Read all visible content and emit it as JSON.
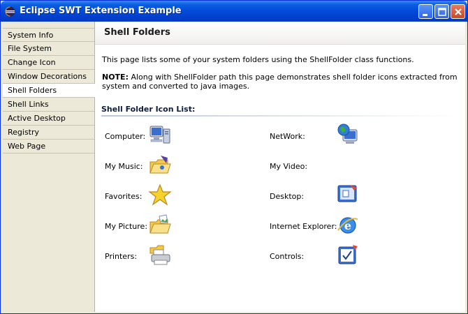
{
  "window": {
    "title": "Eclipse SWT Extension Example"
  },
  "sidebar": {
    "items": [
      {
        "label": "System Info"
      },
      {
        "label": "File System"
      },
      {
        "label": "Change Icon"
      },
      {
        "label": "Window Decorations"
      },
      {
        "label": "Shell Folders",
        "selected": true
      },
      {
        "label": "Shell Links"
      },
      {
        "label": "Active Desktop"
      },
      {
        "label": "Registry"
      },
      {
        "label": "Web Page"
      }
    ]
  },
  "page": {
    "title": "Shell Folders",
    "intro": "This page lists some of your system folders using the ShellFolder class functions.",
    "note_label": "NOTE:",
    "note_text": " Along with ShellFolder path this page demonstrates shell folder icons extracted from system and converted to java images.",
    "section_title": "Shell Folder Icon List:"
  },
  "folders": [
    {
      "label": "Computer:",
      "icon": "computer-icon"
    },
    {
      "label": "NetWork:",
      "icon": "network-icon"
    },
    {
      "label": "My Music:",
      "icon": "music-folder-icon"
    },
    {
      "label": "My Video:",
      "icon": ""
    },
    {
      "label": "Favorites:",
      "icon": "favorites-star-icon"
    },
    {
      "label": "Desktop:",
      "icon": "desktop-icon"
    },
    {
      "label": "My Picture:",
      "icon": "picture-folder-icon"
    },
    {
      "label": "Internet Explorer:",
      "icon": "internet-explorer-icon"
    },
    {
      "label": "Printers:",
      "icon": "printer-icon"
    },
    {
      "label": "Controls:",
      "icon": "control-panel-icon"
    }
  ],
  "colors": {
    "titlebar": "#0348d8",
    "sidebar_bg": "#ece9d8",
    "selected_bg": "#ffffff"
  }
}
